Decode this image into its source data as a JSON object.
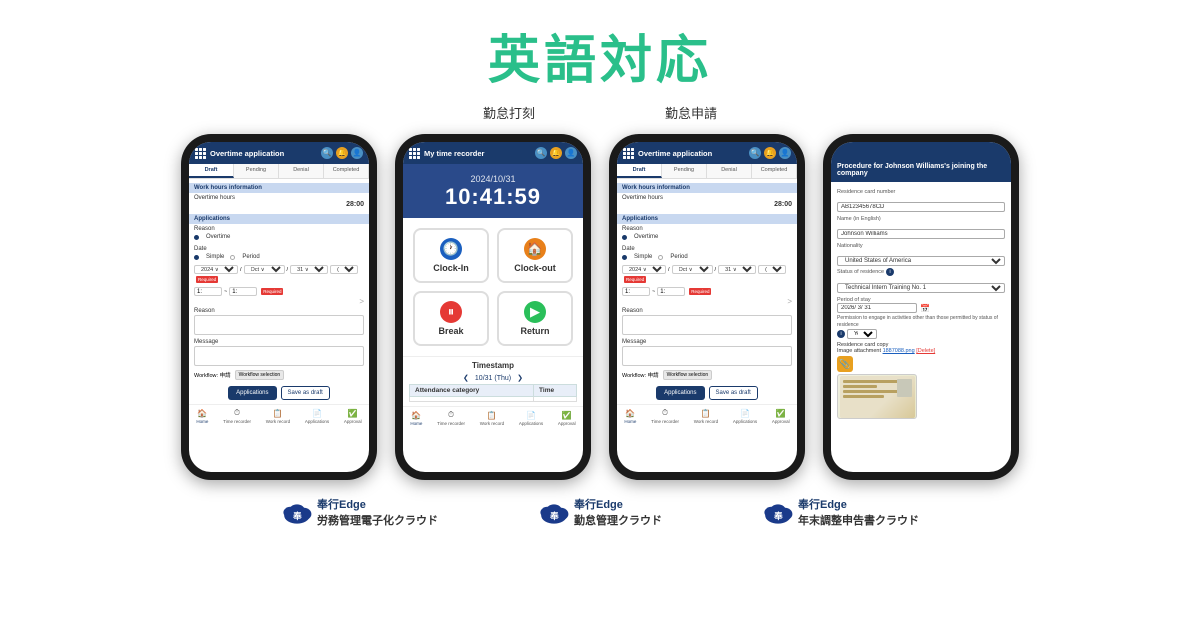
{
  "page": {
    "title": "英語対応",
    "subtitles": [
      "勤怠打刻",
      "勤怠申請"
    ]
  },
  "phone1": {
    "header_title": "Overtime application",
    "tabs": [
      "Draft",
      "Pending",
      "Denial",
      "Completed"
    ],
    "active_tab": 0,
    "sections": {
      "work_hours": "Work hours information",
      "overtime_label": "Overtime hours",
      "overtime_value": "28:00",
      "applications": "Applications",
      "reason_label": "Reason",
      "overtime_text": "Overtime",
      "date_label": "Date",
      "simple_label": "Simple",
      "period_label": "Period",
      "year": "2024",
      "month": "Oct",
      "day": "31",
      "day_of_week": "Thu",
      "required": "Required",
      "reason_textarea_label": "Reason",
      "message_label": "Message",
      "workflow_label": "Workflow: 申請",
      "workflow_btn": "Workflow selection"
    },
    "buttons": {
      "applications": "Applications",
      "save": "Save as draft"
    },
    "nav": [
      "Home",
      "Time recorder",
      "Work record",
      "Applications",
      "Approval"
    ]
  },
  "phone2": {
    "header_title": "My time recorder",
    "date": "2024/10/31",
    "time": "10:41:59",
    "buttons": [
      {
        "label": "Clock-In",
        "icon": "🕐",
        "color": "clock-in"
      },
      {
        "label": "Clock-out",
        "icon": "🏠",
        "color": "clock-out"
      },
      {
        "label": "Break",
        "icon": "⏸",
        "color": "break"
      },
      {
        "label": "Return",
        "icon": "▶",
        "color": "return"
      }
    ],
    "timestamp_header": "Timestamp",
    "timestamp_nav": "10/31 (Thu)",
    "table_headers": [
      "Attendance category",
      "Time"
    ],
    "nav": [
      "Home",
      "Time recorder",
      "Work record",
      "Applications",
      "Approval"
    ]
  },
  "phone3": {
    "header_title": "Overtime application",
    "tabs": [
      "Draft",
      "Pending",
      "Denial",
      "Completed"
    ],
    "active_tab": 0,
    "sections": {
      "work_hours": "Work hours information",
      "overtime_label": "Overtime hours",
      "overtime_value": "28:00",
      "applications": "Applications",
      "reason_label": "Reason",
      "overtime_text": "Overtime",
      "date_label": "Date",
      "simple_label": "Simple",
      "period_label": "Period",
      "year": "2024",
      "month": "Oct",
      "day": "31",
      "day_of_week": "Thu",
      "required": "Required",
      "reason_textarea_label": "Reason",
      "message_label": "Message",
      "workflow_label": "Workflow: 申請",
      "workflow_btn": "Workflow selection"
    },
    "buttons": {
      "applications": "Applications",
      "save": "Save as draft"
    },
    "nav": [
      "Home",
      "Time recorder",
      "Work record",
      "Applications",
      "Approval"
    ]
  },
  "phone4": {
    "header_title": "Procedure for Johnson Williams's joining the company",
    "fields": [
      {
        "label": "Residence card number",
        "value": "AB12345678CD",
        "type": "input"
      },
      {
        "label": "Name (in English)",
        "value": "Johnson Williams",
        "type": "input"
      },
      {
        "label": "Nationality",
        "value": "United States of America",
        "type": "select"
      },
      {
        "label": "Status of residence",
        "value": "Technical Intern Training No. 1",
        "type": "select_info"
      },
      {
        "label": "Period of stay",
        "value": "2026/ 3/ 31 📅",
        "type": "date"
      },
      {
        "label": "Permission to engage in activities other than those permitted by status of residence",
        "value": "",
        "type": "info_toggle"
      },
      {
        "label": "Residence card copy",
        "type": "file"
      }
    ],
    "yes_label": "Yes",
    "file_label": "Image attachment",
    "file_link": "1887088.png",
    "delete_label": "[Delete]"
  },
  "logos": [
    {
      "brand": "奉行Edge",
      "product": "労務管理電子化クラウド"
    },
    {
      "brand": "奉行Edge",
      "product": "勤怠管理クラウド"
    },
    {
      "brand": "奉行Edge",
      "product": "年末調整申告書クラウド"
    }
  ]
}
